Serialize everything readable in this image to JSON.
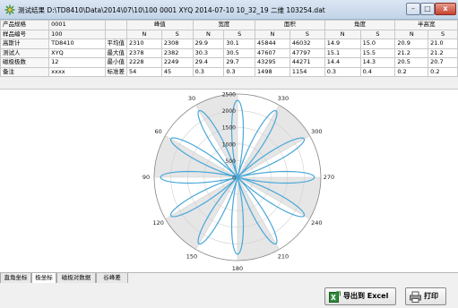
{
  "window": {
    "title": "测试结果 D:\\TD8410\\Data\\2014\\07\\10\\100 0001 XYQ 2014-07-10 10_32_19 二维 103254.dat",
    "min_glyph": "–",
    "max_glyph": "□",
    "close_glyph": "x"
  },
  "info": [
    {
      "label": "产品规格",
      "value": "0001"
    },
    {
      "label": "样品编号",
      "value": "100"
    },
    {
      "label": "高斯计",
      "value": "TD8410"
    },
    {
      "label": "测试人",
      "value": "XYQ"
    },
    {
      "label": "磁极极数",
      "value": "12"
    },
    {
      "label": "备注",
      "value": "xxxx"
    }
  ],
  "table": {
    "groups": [
      "峰值",
      "宽度",
      "面积",
      "角度",
      "半高宽"
    ],
    "subheaders": [
      "N",
      "S",
      "N",
      "S",
      "N",
      "S",
      "N",
      "S",
      "N",
      "S"
    ],
    "rows": [
      {
        "label": "平均值",
        "values": [
          "2310",
          "2308",
          "29.9",
          "30.1",
          "45844",
          "46032",
          "14.9",
          "15.0",
          "20.9",
          "21.0"
        ]
      },
      {
        "label": "最大值",
        "values": [
          "2378",
          "2382",
          "30.3",
          "30.5",
          "47607",
          "47797",
          "15.1",
          "15.5",
          "21.2",
          "21.2"
        ]
      },
      {
        "label": "最小值",
        "values": [
          "2228",
          "2249",
          "29.4",
          "29.7",
          "43295",
          "44271",
          "14.4",
          "14.3",
          "20.5",
          "20.7"
        ]
      },
      {
        "label": "标准差",
        "values": [
          "54",
          "45",
          "0.3",
          "0.3",
          "1498",
          "1154",
          "0.3",
          "0.4",
          "0.2",
          "0.2"
        ]
      }
    ]
  },
  "polar": {
    "angle_labels": [
      "0",
      "30",
      "60",
      "90",
      "120",
      "150",
      "180",
      "210",
      "240",
      "270",
      "300",
      "330"
    ],
    "radial_labels": [
      "500",
      "1000",
      "1500",
      "2000",
      "2500"
    ],
    "radial_center_label": "0",
    "radial_max": 2500,
    "poles": 12,
    "peak_value": 2310,
    "curve_color": "#4aa8d8"
  },
  "tabs": [
    "直角坐标",
    "极坐标",
    "磁极对数据",
    "谷峰差"
  ],
  "active_tab": 1,
  "buttons": {
    "export": "导出到 Excel",
    "print": "打印"
  }
}
